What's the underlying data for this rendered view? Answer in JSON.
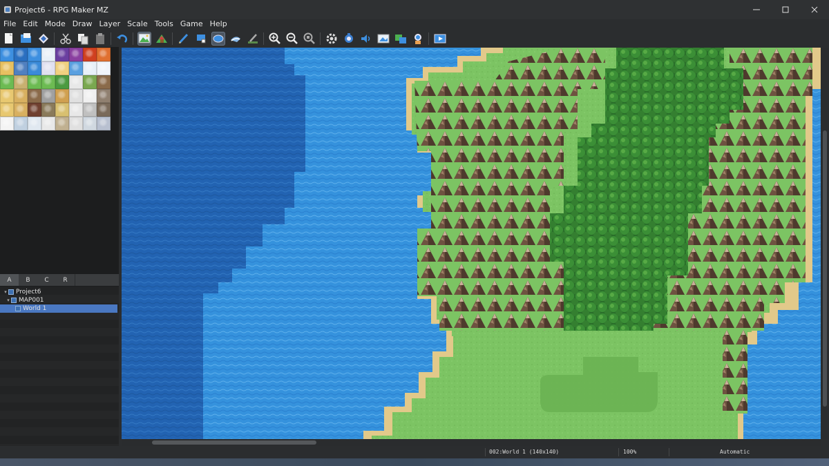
{
  "window": {
    "title": "Project6 - RPG Maker MZ",
    "app_icon": "rpg-maker-icon"
  },
  "menu": [
    "File",
    "Edit",
    "Mode",
    "Draw",
    "Layer",
    "Scale",
    "Tools",
    "Game",
    "Help"
  ],
  "toolbar": {
    "groups": [
      [
        "new-project-icon",
        "open-project-icon",
        "save-project-icon"
      ],
      [
        "cut-icon",
        "copy-icon",
        "paste-icon"
      ],
      [
        "undo-icon"
      ],
      [
        "map-mode-icon",
        "event-mode-icon"
      ],
      [
        "pencil-icon",
        "rectangle-icon",
        "ellipse-icon",
        "fill-icon",
        "shadow-pen-icon"
      ],
      [
        "zoom-in-icon",
        "zoom-out-icon",
        "actual-size-icon"
      ],
      [
        "database-icon",
        "plugin-manager-icon",
        "sound-test-icon",
        "event-searcher-icon",
        "resource-manager-icon",
        "character-generator-icon"
      ],
      [
        "playtest-icon"
      ]
    ],
    "active": [
      "map-mode-icon",
      "ellipse-icon"
    ]
  },
  "tileset_tabs": [
    "A",
    "B",
    "C",
    "R"
  ],
  "active_tab": "A",
  "map_tree": [
    {
      "label": "Project6",
      "level": 0,
      "expanded": true,
      "selected": false
    },
    {
      "label": "MAP001",
      "level": 1,
      "expanded": true,
      "selected": false
    },
    {
      "label": "World 1",
      "level": 2,
      "expanded": false,
      "selected": true
    }
  ],
  "status": {
    "map": "002:World 1 (140x140)",
    "zoom": "100%",
    "mode": "Automatic"
  },
  "colors": {
    "sea": "#2f8ad8",
    "deep_sea": "#1e5fae",
    "grass": "#79c160",
    "sand": "#e6d08a",
    "forest": "#2f7f2f",
    "mountain": "#7a5e48",
    "selection": "#4a78c2"
  }
}
